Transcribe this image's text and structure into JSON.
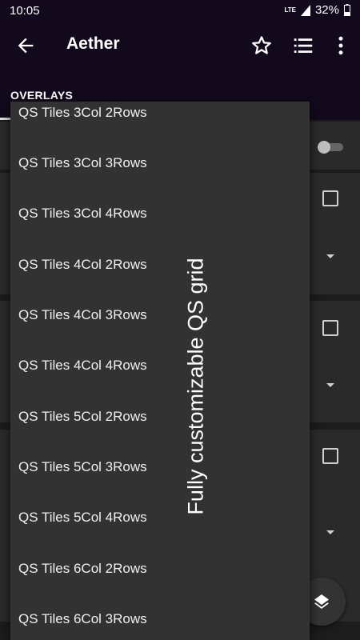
{
  "status": {
    "time": "10:05",
    "battery": "32%",
    "network": "LTE"
  },
  "appbar": {
    "title": "Aether"
  },
  "tab": {
    "label": "OVERLAYS"
  },
  "dropdown": {
    "items": [
      "QS Tiles 3Col 2Rows",
      "QS Tiles 3Col 3Rows",
      "QS Tiles 3Col 4Rows",
      "QS Tiles 4Col 2Rows",
      "QS Tiles 4Col 3Rows",
      "QS Tiles 4Col 4Rows",
      "QS Tiles 5Col 2Rows",
      "QS Tiles 5Col 3Rows",
      "QS Tiles 5Col 4Rows",
      "QS Tiles 6Col 2Rows",
      "QS Tiles 6Col 3Rows"
    ]
  },
  "overlay_caption": "Fully customizable QS grid",
  "colors": {
    "appbar": "#12091c",
    "background": "#1c1c1c",
    "menu": "#323232"
  }
}
